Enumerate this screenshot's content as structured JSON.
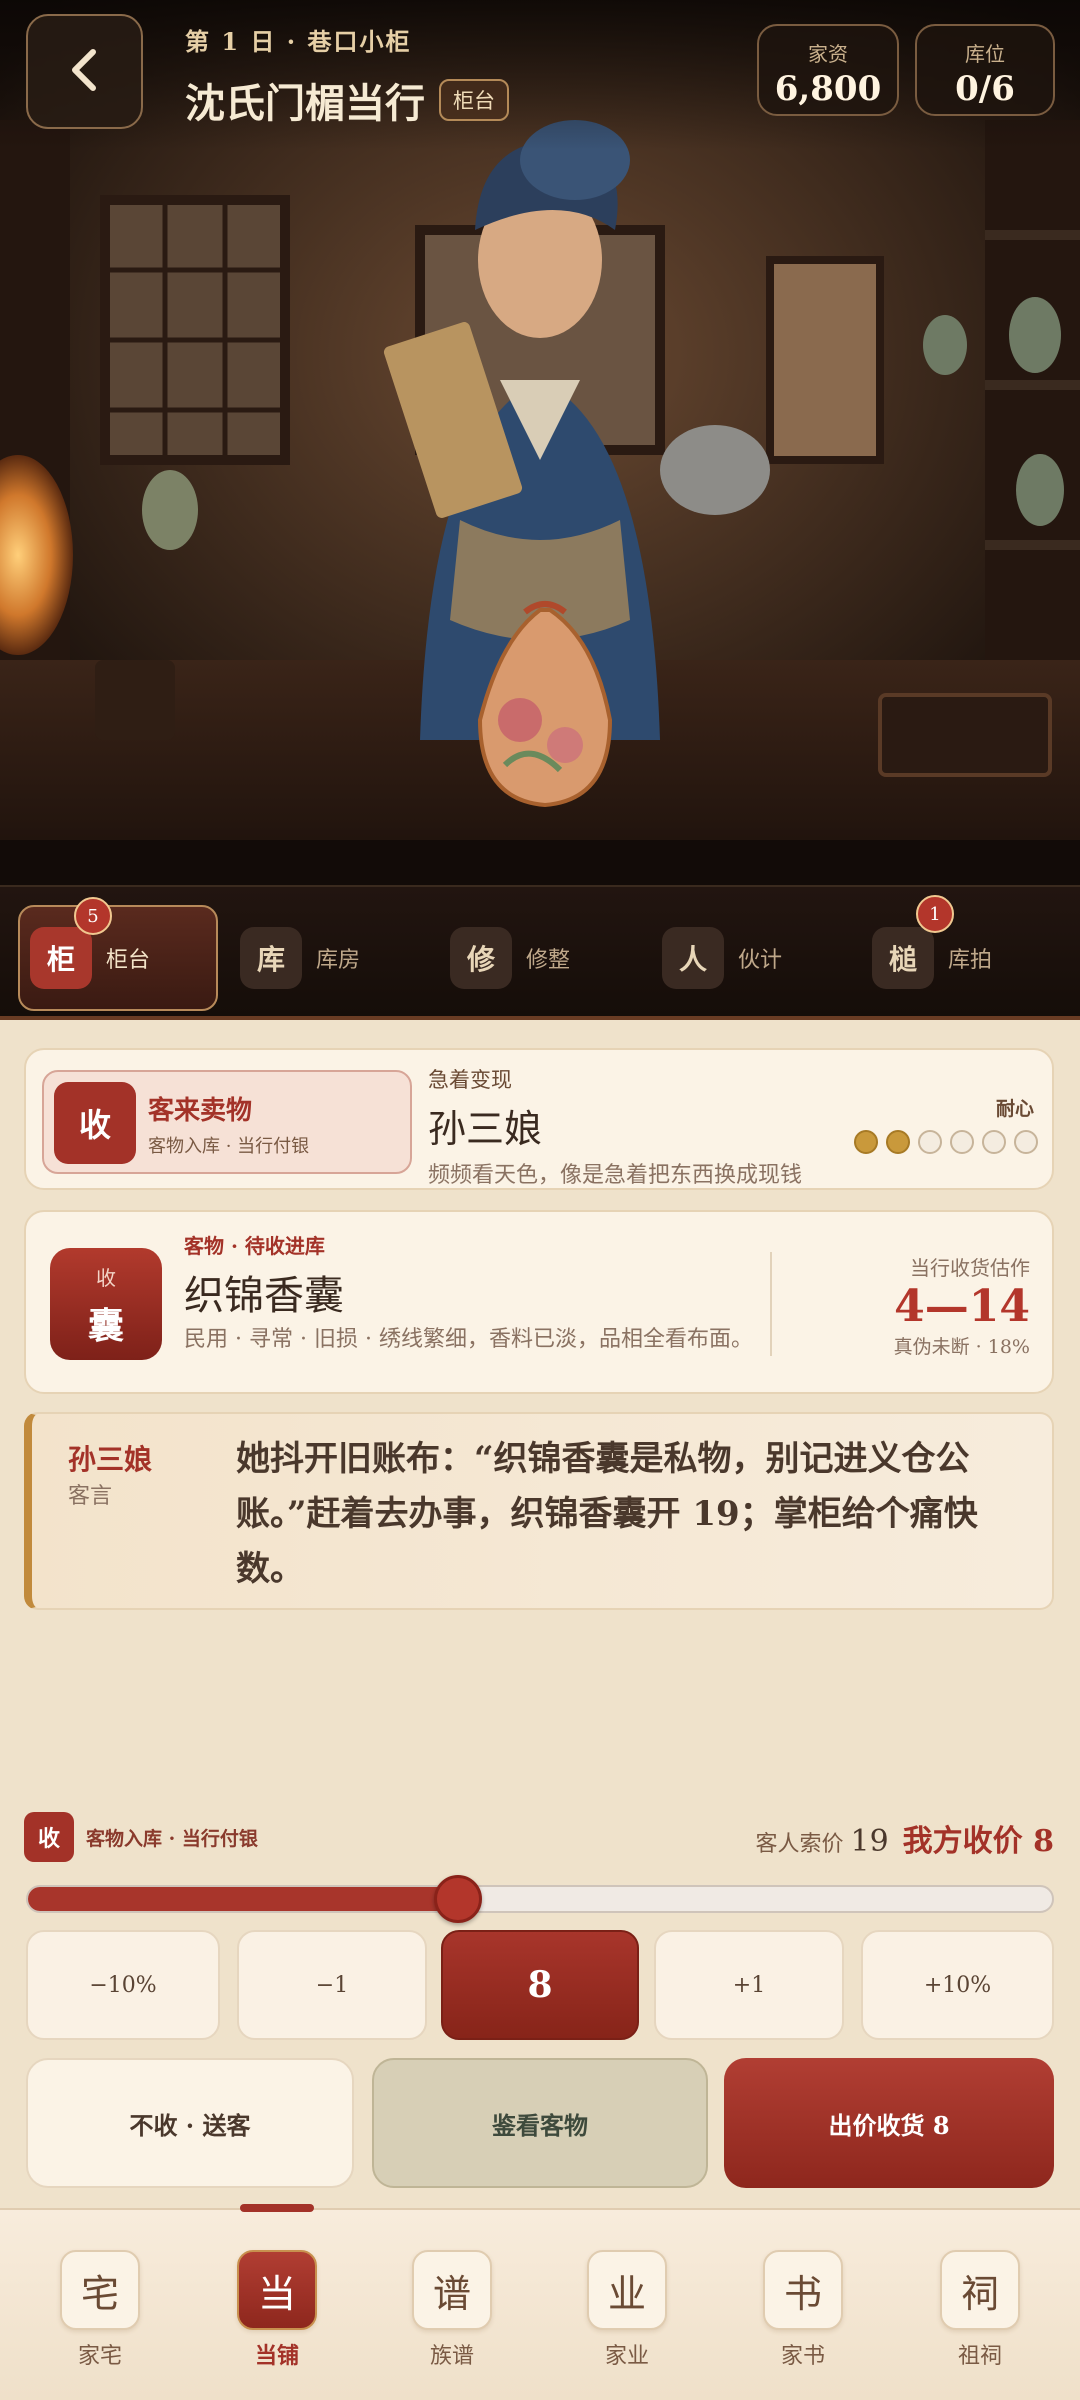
{
  "header": {
    "day_line": "第 1 日 · 巷口小柜",
    "shop_name": "沈氏门楣当行",
    "counter_tag": "柜台",
    "stats": [
      {
        "label": "家资",
        "value": "6,800"
      },
      {
        "label": "库位",
        "value": "0/6"
      }
    ]
  },
  "counter_tabs": [
    {
      "icon": "柜",
      "label": "柜台",
      "badge": "5",
      "active": true
    },
    {
      "icon": "库",
      "label": "库房",
      "badge": ""
    },
    {
      "icon": "修",
      "label": "修整",
      "badge": ""
    },
    {
      "icon": "人",
      "label": "伙计",
      "badge": ""
    },
    {
      "icon": "槌",
      "label": "库拍",
      "badge": "1"
    }
  ],
  "customer": {
    "mode_icon": "收",
    "mode_title": "客来卖物",
    "mode_sub": "客物入库 · 当行付银",
    "tag": "急着变现",
    "name": "孙三娘",
    "desc": "频频看天色，像是急着把东西换成现钱",
    "patience_label": "耐心",
    "patience_filled": 2,
    "patience_total": 6
  },
  "item": {
    "seal_top": "收",
    "seal_char": "囊",
    "category": "客物 · 待收进库",
    "name": "织锦香囊",
    "desc": "民用 · 寻常 · 旧损 · 绣线繁细，香料已淡，品相全看布面。",
    "estimate_label": "当行收货估作",
    "estimate_value": "4—14",
    "estimate_note": "真伪未断 · 18%"
  },
  "quote": {
    "speaker": "孙三娘",
    "role": "客言",
    "text": "她抖开旧账布：“织锦香囊是私物，别记进义仓公账。”赶着去办事，织锦香囊开 19；掌柜给个痛快数。"
  },
  "offer": {
    "mode_icon": "收",
    "mode_text": "客物入库 · 当行付银",
    "ask_label": "客人索价",
    "ask_value": "19",
    "bid_label": "我方收价 8",
    "slider_fraction": 0.42,
    "adjust_buttons": [
      "−10%",
      "−1",
      "8",
      "+1",
      "+10%"
    ],
    "decline_label": "不收 · 送客",
    "inspect_label": "鉴看客物",
    "buy_label": "出价收货 8"
  },
  "bottom_nav": [
    {
      "icon": "宅",
      "label": "家宅"
    },
    {
      "icon": "当",
      "label": "当铺",
      "active": true
    },
    {
      "icon": "谱",
      "label": "族谱"
    },
    {
      "icon": "业",
      "label": "家业"
    },
    {
      "icon": "书",
      "label": "家书"
    },
    {
      "icon": "祠",
      "label": "祖祠"
    }
  ],
  "colors": {
    "accent": "#a33228",
    "gold": "#c9993b",
    "panel": "#fbf3e6"
  }
}
